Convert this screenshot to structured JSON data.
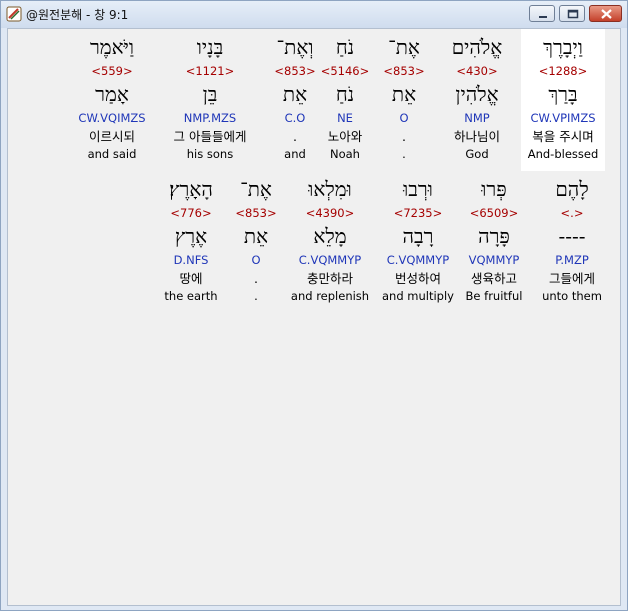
{
  "window": {
    "title": "@원전분해 - 창 9:1"
  },
  "words": [
    {
      "hebrew": "וַיְבָרֶךְ",
      "strong": "<1288>",
      "lemma": "בָּרַךְ",
      "parse": "CW.VPIMZS",
      "korean": "복을 주시며",
      "english": "And-blessed"
    },
    {
      "hebrew": "אֱלֹהִים",
      "strong": "<430>",
      "lemma": "אֱלֹהִין",
      "parse": "NMP",
      "korean": "하나님이",
      "english": "God"
    },
    {
      "hebrew": "אֶת־",
      "strong": "<853>",
      "lemma": "אֵת",
      "parse": "O",
      "korean": ".",
      "english": "."
    },
    {
      "hebrew": "נֹחַ",
      "strong": "<5146>",
      "lemma": "נֹחַ",
      "parse": "NE",
      "korean": "노아와",
      "english": "Noah"
    },
    {
      "hebrew": "וְאֶת־",
      "strong": "<853>",
      "lemma": "אֵת",
      "parse": "C.O",
      "korean": ".",
      "english": "and"
    },
    {
      "hebrew": "בָּנָיו",
      "strong": "<1121>",
      "lemma": "בֵּן",
      "parse": "NMP.MZS",
      "korean": "그 아들들에게",
      "english": "his sons"
    },
    {
      "hebrew": "וַיֹּאמֶר",
      "strong": "<559>",
      "lemma": "אָמַר",
      "parse": "CW.VQIMZS",
      "korean": "이르시되",
      "english": "and said"
    },
    {
      "hebrew": "לָהֶם",
      "strong": "<.>",
      "lemma": "----",
      "parse": "P.MZP",
      "korean": "그들에게",
      "english": "unto them"
    },
    {
      "hebrew": "פְּרוּ",
      "strong": "<6509>",
      "lemma": "פָּרָה",
      "parse": "VQMMYP",
      "korean": "생육하고",
      "english": "Be fruitful"
    },
    {
      "hebrew": "וּרְבוּ",
      "strong": "<7235>",
      "lemma": "רָבָה",
      "parse": "C.VQMMYP",
      "korean": "번성하여",
      "english": "and multiply"
    },
    {
      "hebrew": "וּמִלְאוּ",
      "strong": "<4390>",
      "lemma": "מָלֵא",
      "parse": "C.VQMMYP",
      "korean": "충만하라",
      "english": "and replenish"
    },
    {
      "hebrew": "אֶת־",
      "strong": "<853>",
      "lemma": "אֵת",
      "parse": "O",
      "korean": ".",
      "english": "."
    },
    {
      "hebrew": "הָאָרֶץ׃",
      "strong": "<776>",
      "lemma": "אֶרֶץ",
      "parse": "D.NFS",
      "korean": "땅에",
      "english": "the earth"
    }
  ]
}
